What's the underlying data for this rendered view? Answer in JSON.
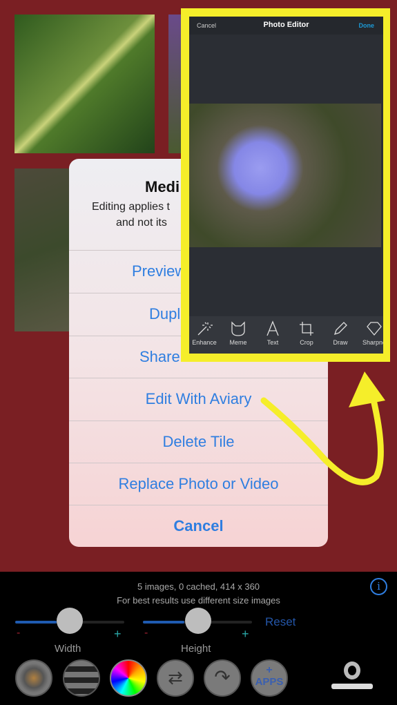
{
  "sheet": {
    "title": "Medi",
    "message_line1": "Editing applies t",
    "message_line2": "and not its",
    "items": [
      "Preview",
      "Dupl",
      "Share",
      "Edit With Aviary",
      "Delete Tile",
      "Replace Photo or Video"
    ],
    "cancel": "Cancel"
  },
  "editor": {
    "cancel": "Cancel",
    "title": "Photo Editor",
    "done": "Done",
    "tools": [
      "Enhance",
      "Meme",
      "Text",
      "Crop",
      "Draw",
      "Sharpne"
    ]
  },
  "panel": {
    "info_line1": "5 images, 0 cached, 414 x 360",
    "info_line2": "For best results use different size images",
    "reset": "Reset",
    "width_label": "Width",
    "height_label": "Height",
    "minus": "-",
    "plus": "+",
    "apps_label": "APPS",
    "width_slider": 0.5,
    "height_slider": 0.5
  },
  "colors": {
    "background": "#7a1f23",
    "accent": "#2f7ee0",
    "highlight": "#f5ee2a"
  }
}
